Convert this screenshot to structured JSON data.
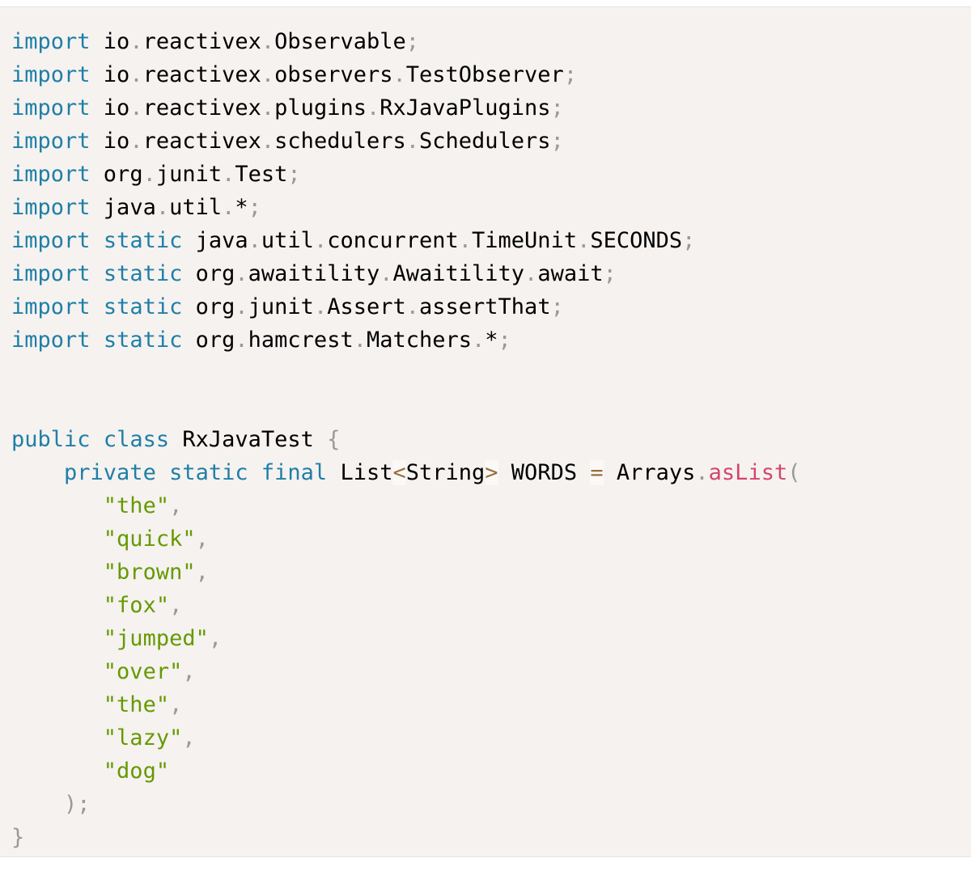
{
  "colors": {
    "background": "#f5f2f0",
    "keyword": "#1f7fa6",
    "string": "#669900",
    "function": "#d4456e",
    "punctuation": "#999999",
    "operator": "#9a6e3a",
    "text": "#000000"
  },
  "code": {
    "language": "java",
    "lines": [
      [
        {
          "t": "kw",
          "v": "import"
        },
        {
          "t": "plain",
          "v": " io"
        },
        {
          "t": "punc",
          "v": "."
        },
        {
          "t": "plain",
          "v": "reactivex"
        },
        {
          "t": "punc",
          "v": "."
        },
        {
          "t": "plain",
          "v": "Observable"
        },
        {
          "t": "punc",
          "v": ";"
        }
      ],
      [
        {
          "t": "kw",
          "v": "import"
        },
        {
          "t": "plain",
          "v": " io"
        },
        {
          "t": "punc",
          "v": "."
        },
        {
          "t": "plain",
          "v": "reactivex"
        },
        {
          "t": "punc",
          "v": "."
        },
        {
          "t": "plain",
          "v": "observers"
        },
        {
          "t": "punc",
          "v": "."
        },
        {
          "t": "plain",
          "v": "TestObserver"
        },
        {
          "t": "punc",
          "v": ";"
        }
      ],
      [
        {
          "t": "kw",
          "v": "import"
        },
        {
          "t": "plain",
          "v": " io"
        },
        {
          "t": "punc",
          "v": "."
        },
        {
          "t": "plain",
          "v": "reactivex"
        },
        {
          "t": "punc",
          "v": "."
        },
        {
          "t": "plain",
          "v": "plugins"
        },
        {
          "t": "punc",
          "v": "."
        },
        {
          "t": "plain",
          "v": "RxJavaPlugins"
        },
        {
          "t": "punc",
          "v": ";"
        }
      ],
      [
        {
          "t": "kw",
          "v": "import"
        },
        {
          "t": "plain",
          "v": " io"
        },
        {
          "t": "punc",
          "v": "."
        },
        {
          "t": "plain",
          "v": "reactivex"
        },
        {
          "t": "punc",
          "v": "."
        },
        {
          "t": "plain",
          "v": "schedulers"
        },
        {
          "t": "punc",
          "v": "."
        },
        {
          "t": "plain",
          "v": "Schedulers"
        },
        {
          "t": "punc",
          "v": ";"
        }
      ],
      [
        {
          "t": "kw",
          "v": "import"
        },
        {
          "t": "plain",
          "v": " org"
        },
        {
          "t": "punc",
          "v": "."
        },
        {
          "t": "plain",
          "v": "junit"
        },
        {
          "t": "punc",
          "v": "."
        },
        {
          "t": "plain",
          "v": "Test"
        },
        {
          "t": "punc",
          "v": ";"
        }
      ],
      [
        {
          "t": "kw",
          "v": "import"
        },
        {
          "t": "plain",
          "v": " java"
        },
        {
          "t": "punc",
          "v": "."
        },
        {
          "t": "plain",
          "v": "util"
        },
        {
          "t": "punc",
          "v": "."
        },
        {
          "t": "plain",
          "v": "*"
        },
        {
          "t": "punc",
          "v": ";"
        }
      ],
      [
        {
          "t": "kw",
          "v": "import"
        },
        {
          "t": "plain",
          "v": " "
        },
        {
          "t": "kw",
          "v": "static"
        },
        {
          "t": "plain",
          "v": " java"
        },
        {
          "t": "punc",
          "v": "."
        },
        {
          "t": "plain",
          "v": "util"
        },
        {
          "t": "punc",
          "v": "."
        },
        {
          "t": "plain",
          "v": "concurrent"
        },
        {
          "t": "punc",
          "v": "."
        },
        {
          "t": "plain",
          "v": "TimeUnit"
        },
        {
          "t": "punc",
          "v": "."
        },
        {
          "t": "plain",
          "v": "SECONDS"
        },
        {
          "t": "punc",
          "v": ";"
        }
      ],
      [
        {
          "t": "kw",
          "v": "import"
        },
        {
          "t": "plain",
          "v": " "
        },
        {
          "t": "kw",
          "v": "static"
        },
        {
          "t": "plain",
          "v": " org"
        },
        {
          "t": "punc",
          "v": "."
        },
        {
          "t": "plain",
          "v": "awaitility"
        },
        {
          "t": "punc",
          "v": "."
        },
        {
          "t": "plain",
          "v": "Awaitility"
        },
        {
          "t": "punc",
          "v": "."
        },
        {
          "t": "plain",
          "v": "await"
        },
        {
          "t": "punc",
          "v": ";"
        }
      ],
      [
        {
          "t": "kw",
          "v": "import"
        },
        {
          "t": "plain",
          "v": " "
        },
        {
          "t": "kw",
          "v": "static"
        },
        {
          "t": "plain",
          "v": " org"
        },
        {
          "t": "punc",
          "v": "."
        },
        {
          "t": "plain",
          "v": "junit"
        },
        {
          "t": "punc",
          "v": "."
        },
        {
          "t": "plain",
          "v": "Assert"
        },
        {
          "t": "punc",
          "v": "."
        },
        {
          "t": "plain",
          "v": "assertThat"
        },
        {
          "t": "punc",
          "v": ";"
        }
      ],
      [
        {
          "t": "kw",
          "v": "import"
        },
        {
          "t": "plain",
          "v": " "
        },
        {
          "t": "kw",
          "v": "static"
        },
        {
          "t": "plain",
          "v": " org"
        },
        {
          "t": "punc",
          "v": "."
        },
        {
          "t": "plain",
          "v": "hamcrest"
        },
        {
          "t": "punc",
          "v": "."
        },
        {
          "t": "plain",
          "v": "Matchers"
        },
        {
          "t": "punc",
          "v": "."
        },
        {
          "t": "plain",
          "v": "*"
        },
        {
          "t": "punc",
          "v": ";"
        }
      ],
      [],
      [],
      [
        {
          "t": "kw",
          "v": "public"
        },
        {
          "t": "plain",
          "v": " "
        },
        {
          "t": "kw",
          "v": "class"
        },
        {
          "t": "plain",
          "v": " RxJavaTest "
        },
        {
          "t": "punc",
          "v": "{"
        }
      ],
      [
        {
          "t": "plain",
          "v": "    "
        },
        {
          "t": "kw",
          "v": "private"
        },
        {
          "t": "plain",
          "v": " "
        },
        {
          "t": "kw",
          "v": "static"
        },
        {
          "t": "plain",
          "v": " "
        },
        {
          "t": "kw",
          "v": "final"
        },
        {
          "t": "plain",
          "v": " List"
        },
        {
          "t": "op",
          "v": "<"
        },
        {
          "t": "plain",
          "v": "String"
        },
        {
          "t": "op",
          "v": ">"
        },
        {
          "t": "plain",
          "v": " WORDS "
        },
        {
          "t": "op",
          "v": "="
        },
        {
          "t": "plain",
          "v": " Arrays"
        },
        {
          "t": "punc",
          "v": "."
        },
        {
          "t": "fn",
          "v": "asList"
        },
        {
          "t": "punc",
          "v": "("
        }
      ],
      [
        {
          "t": "plain",
          "v": "       "
        },
        {
          "t": "str",
          "v": "\"the\""
        },
        {
          "t": "punc",
          "v": ","
        }
      ],
      [
        {
          "t": "plain",
          "v": "       "
        },
        {
          "t": "str",
          "v": "\"quick\""
        },
        {
          "t": "punc",
          "v": ","
        }
      ],
      [
        {
          "t": "plain",
          "v": "       "
        },
        {
          "t": "str",
          "v": "\"brown\""
        },
        {
          "t": "punc",
          "v": ","
        }
      ],
      [
        {
          "t": "plain",
          "v": "       "
        },
        {
          "t": "str",
          "v": "\"fox\""
        },
        {
          "t": "punc",
          "v": ","
        }
      ],
      [
        {
          "t": "plain",
          "v": "       "
        },
        {
          "t": "str",
          "v": "\"jumped\""
        },
        {
          "t": "punc",
          "v": ","
        }
      ],
      [
        {
          "t": "plain",
          "v": "       "
        },
        {
          "t": "str",
          "v": "\"over\""
        },
        {
          "t": "punc",
          "v": ","
        }
      ],
      [
        {
          "t": "plain",
          "v": "       "
        },
        {
          "t": "str",
          "v": "\"the\""
        },
        {
          "t": "punc",
          "v": ","
        }
      ],
      [
        {
          "t": "plain",
          "v": "       "
        },
        {
          "t": "str",
          "v": "\"lazy\""
        },
        {
          "t": "punc",
          "v": ","
        }
      ],
      [
        {
          "t": "plain",
          "v": "       "
        },
        {
          "t": "str",
          "v": "\"dog\""
        }
      ],
      [
        {
          "t": "plain",
          "v": "    "
        },
        {
          "t": "punc",
          "v": ");"
        }
      ],
      [
        {
          "t": "punc",
          "v": "}"
        }
      ]
    ]
  }
}
